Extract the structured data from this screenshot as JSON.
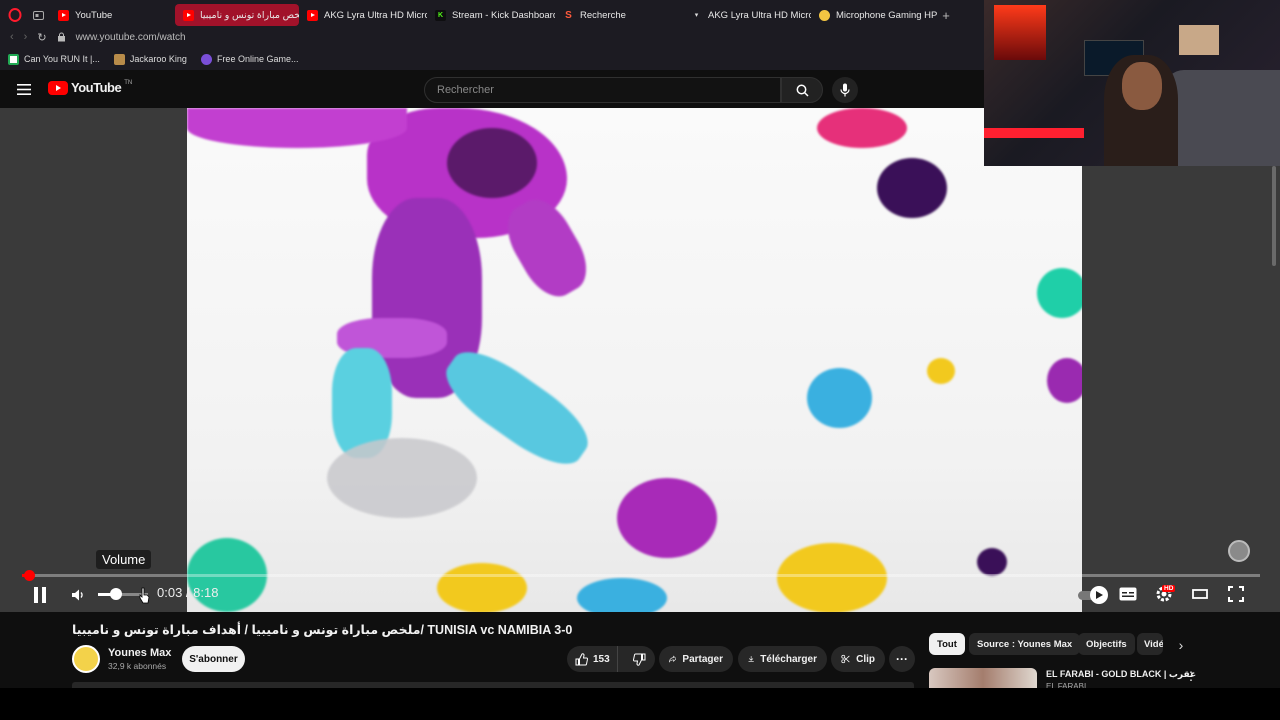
{
  "browser": {
    "tabs": [
      {
        "label": "YouTube",
        "icon": "youtube-icon",
        "active": false
      },
      {
        "label": "ملخص مباراة تونس و ناميبيا",
        "icon": "youtube-icon",
        "active": true
      },
      {
        "label": "AKG Lyra Ultra HD Microp",
        "icon": "youtube-icon",
        "active": false
      },
      {
        "label": "Stream - Kick Dashboard",
        "icon": "kick-icon",
        "active": false
      },
      {
        "label": "Recherche",
        "icon": "search-s-icon",
        "active": false
      },
      {
        "label": "AKG Lyra Ultra HD Microp",
        "icon": "akg-icon",
        "active": false
      },
      {
        "label": "Microphone Gaming HP H",
        "icon": "hp-icon",
        "active": false
      }
    ],
    "url": "www.youtube.com/watch",
    "bookmarks": [
      {
        "label": "Can You RUN It |...",
        "icon": "canyourunit-icon"
      },
      {
        "label": "Jackaroo King",
        "icon": "jackaroo-icon"
      },
      {
        "label": "Free Online Game...",
        "icon": "game-icon"
      }
    ],
    "accent_color": "#a1122a"
  },
  "youtube": {
    "logo_text": "YouTube",
    "logo_suffix": "TN",
    "search_placeholder": "Rechercher"
  },
  "player": {
    "tooltip": "Volume",
    "current_time": "0:03",
    "separator": " / ",
    "duration": "8:18",
    "progress_fraction": 0.006,
    "volume_fraction": 0.35,
    "quality_badge": "HD"
  },
  "video_info": {
    "title": "ملخص مباراة تونس و ناميبيا / أهداف مباراة تونس و ناميبيا/ TUNISIA vc NAMIBIA 3-0",
    "channel_name": "Younes Max",
    "subscribers": "32,9 k abonnés",
    "subscribe_label": "S'abonner",
    "likes": "153",
    "share_label": "Partager",
    "download_label": "Télécharger",
    "clip_label": "Clip"
  },
  "chips": [
    "Tout",
    "Source : Younes Max",
    "Objectifs",
    "Vidé"
  ],
  "recommendation": {
    "title": "EL FARABI - GOLD BLACK | عقرب",
    "channel": "EL FARABI"
  }
}
